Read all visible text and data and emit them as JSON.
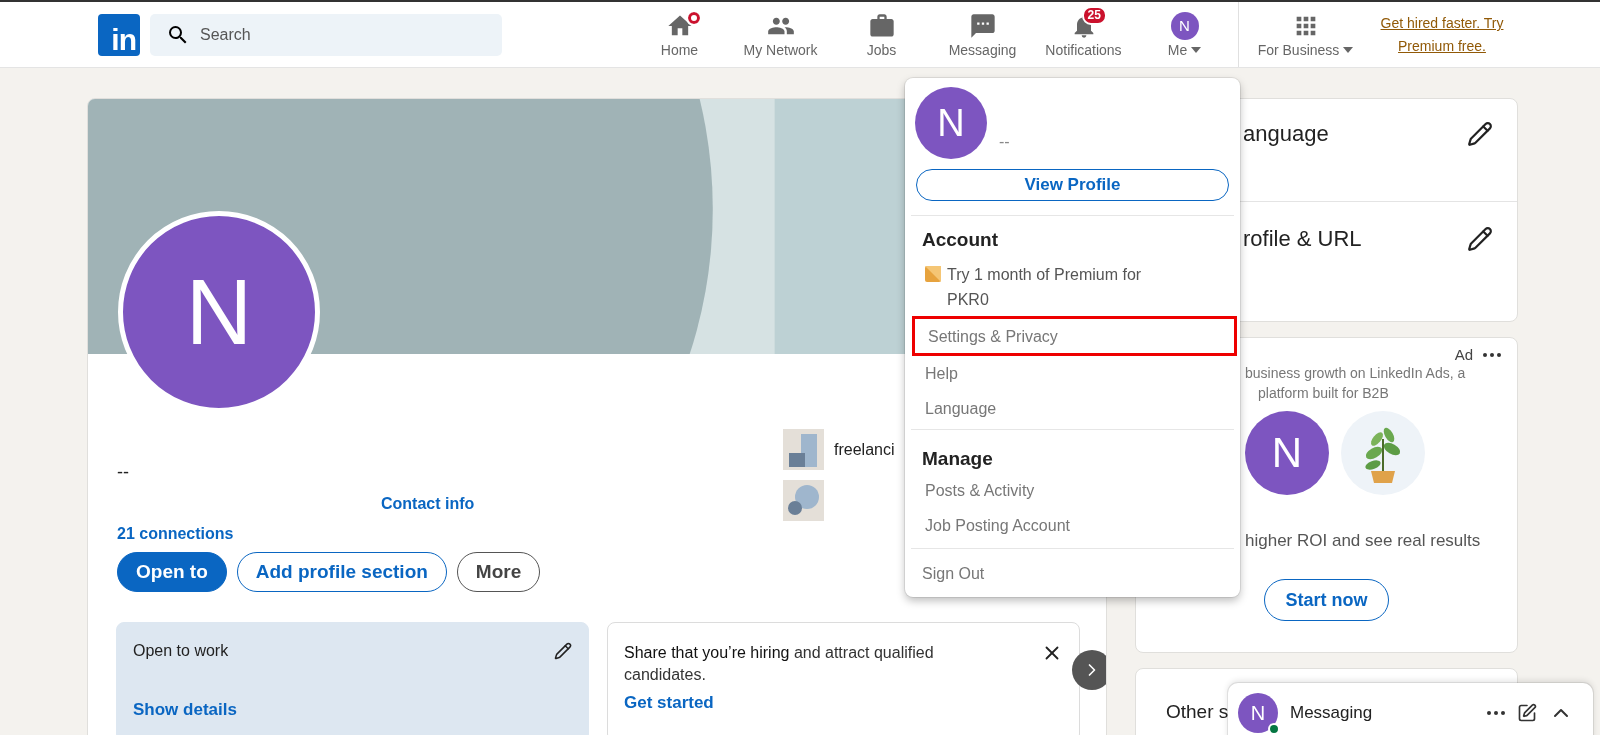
{
  "header": {
    "logo": "in",
    "search": {
      "placeholder": "Search"
    },
    "nav": [
      {
        "label": "Home",
        "kind": "home",
        "dot": true
      },
      {
        "label": "My Network",
        "kind": "network",
        "dot": false
      },
      {
        "label": "Jobs",
        "kind": "jobs",
        "dot": false
      },
      {
        "label": "Messaging",
        "kind": "messaging",
        "dot": false
      },
      {
        "label": "Notifications",
        "kind": "bell",
        "dot": false,
        "badge": "25"
      },
      {
        "label": "Me",
        "kind": "avatar",
        "dot": false,
        "initial": "N"
      }
    ],
    "for_business": "For Business",
    "premium_link": "Get hired faster. Try Premium free."
  },
  "profile": {
    "initial": "N",
    "name": "--",
    "contact": "Contact info",
    "connections": "21 connections",
    "buttons": [
      {
        "label": "Open to",
        "kind": "primary"
      },
      {
        "label": "Add profile section",
        "kind": "outline"
      },
      {
        "label": "More",
        "kind": "plain"
      }
    ],
    "links": [
      {
        "kind": "squares",
        "label": "freelanci"
      },
      {
        "kind": "circles"
      }
    ]
  },
  "open_to_work": {
    "title": "Open to work",
    "link": "Show details"
  },
  "hiring": {
    "text": "**Share that you’re hiring** and attract qualified candidates.",
    "link": "Get started"
  },
  "sidebar": {
    "settings": [
      {
        "label": "anguage"
      },
      {
        "label": "rofile & URL"
      }
    ],
    "ad": {
      "label": "Ad",
      "lines": [
        "business growth on LinkedIn Ads, a",
        "platform built for B2B"
      ],
      "initial": "N",
      "tagline": "higher ROI and see real results",
      "button": "Start now"
    },
    "other": "Other s"
  },
  "menu": {
    "initial": "N",
    "name": "--",
    "view_profile": "View Profile",
    "sections": [
      {
        "title": "Account",
        "items": [
          {
            "label": "Try 1 month of Premium for PKR0",
            "kind": "premium",
            "highlighted": false
          },
          {
            "label": "Settings & Privacy",
            "kind": "plain",
            "highlighted": true
          },
          {
            "label": "Help",
            "kind": "plain",
            "highlighted": false
          },
          {
            "label": "Language",
            "kind": "plain",
            "highlighted": false
          }
        ]
      },
      {
        "title": "Manage",
        "items": [
          {
            "label": "Posts & Activity",
            "kind": "plain",
            "highlighted": false
          },
          {
            "label": "Job Posting Account",
            "kind": "plain",
            "highlighted": false
          }
        ]
      }
    ],
    "sign_out": "Sign Out"
  },
  "messaging": {
    "initial": "N",
    "online": true,
    "title": "Messaging"
  }
}
